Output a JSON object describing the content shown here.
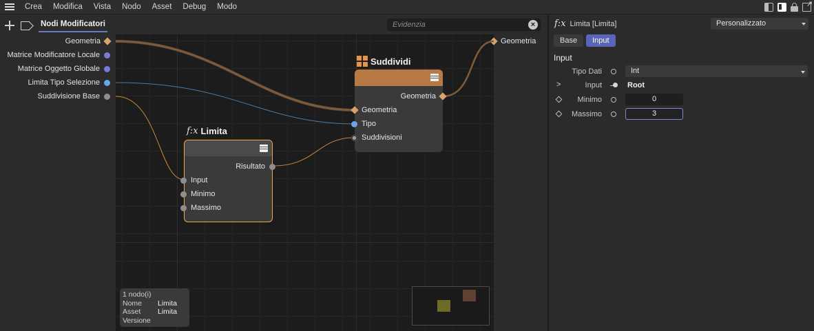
{
  "menubar": {
    "items": [
      "Crea",
      "Modifica",
      "Vista",
      "Nodo",
      "Asset",
      "Debug",
      "Modo"
    ]
  },
  "editor": {
    "tab_label": "Nodi Modificatori",
    "search_placeholder": "Evidenzia",
    "input_ports": [
      {
        "label": "Geometria",
        "kind": "diamond",
        "color": "#d9a36b"
      },
      {
        "label": "Matrice Modificatore Locale",
        "kind": "dot",
        "color": "#7b7ad6"
      },
      {
        "label": "Matrice Oggetto Globale",
        "kind": "dot",
        "color": "#7b7ad6"
      },
      {
        "label": "Limita Tipo Selezione",
        "kind": "dot",
        "color": "#69a6e6"
      },
      {
        "label": "Suddivisione Base",
        "kind": "dot",
        "color": "#8e8e8e"
      }
    ],
    "output_port": {
      "label": "Geometria"
    },
    "nodes": {
      "suddividi": {
        "title": "Suddividi",
        "header_color": "#b87a44",
        "outputs": [
          "Geometria"
        ],
        "inputs": [
          "Geometria",
          "Tipo",
          "Suddivisioni"
        ]
      },
      "limita": {
        "title": "Limita",
        "icon": "f:x",
        "header_color": "#4a4a4a",
        "border_color": "#f0a84a",
        "outputs": [
          "Risultato"
        ],
        "inputs": [
          "Input",
          "Minimo",
          "Massimo"
        ]
      }
    },
    "info": {
      "count": "1 nodo(i)",
      "rows": [
        {
          "key": "Nome",
          "value": "Limita"
        },
        {
          "key": "Asset",
          "value": "Limita"
        },
        {
          "key": "Versione",
          "value": ""
        }
      ]
    }
  },
  "attributes": {
    "icon": "f:x",
    "title": "Limita [Limita]",
    "preset": "Personalizzato",
    "tabs": [
      {
        "label": "Base",
        "active": false
      },
      {
        "label": "Input",
        "active": true
      }
    ],
    "section": "Input",
    "params": {
      "tipo_dati": {
        "label": "Tipo Dati",
        "value": "Int"
      },
      "input": {
        "label": "Input",
        "value": "Root"
      },
      "minimo": {
        "label": "Minimo",
        "value": "0"
      },
      "massimo": {
        "label": "Massimo",
        "value": "3"
      }
    }
  }
}
